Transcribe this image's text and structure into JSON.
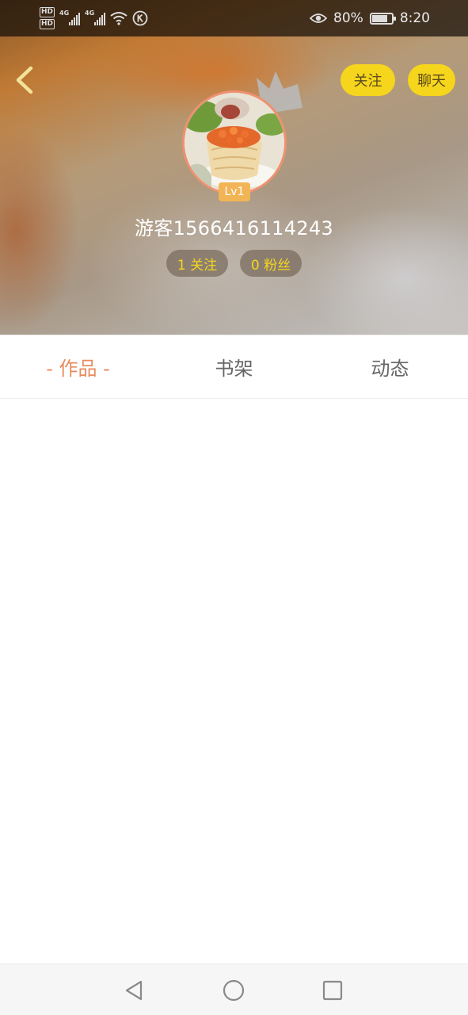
{
  "status_bar": {
    "hd1": "HD",
    "hd2": "HD",
    "network1": "4G",
    "network2": "4G",
    "battery_text": "80%",
    "battery_level": 0.8,
    "time": "8:20"
  },
  "profile": {
    "follow_label": "关注",
    "chat_label": "聊天",
    "level": "Lv1",
    "username": "游客1566416114243",
    "following_text": "1 关注",
    "fans_text": "0 粉丝"
  },
  "tabs": [
    {
      "label": "- 作品 -",
      "active": true
    },
    {
      "label": "书架",
      "active": false
    },
    {
      "label": "动态",
      "active": false
    }
  ],
  "colors": {
    "accent_yellow": "#f6d51d",
    "active_tab": "#e88b5f",
    "avatar_border": "#ef9170",
    "level_badge": "#f2b556"
  },
  "icons": {
    "back": "chevron-left-icon",
    "crown": "crown-icon",
    "nav_back": "triangle-back-icon",
    "nav_home": "circle-home-icon",
    "nav_recent": "square-recent-icon"
  }
}
